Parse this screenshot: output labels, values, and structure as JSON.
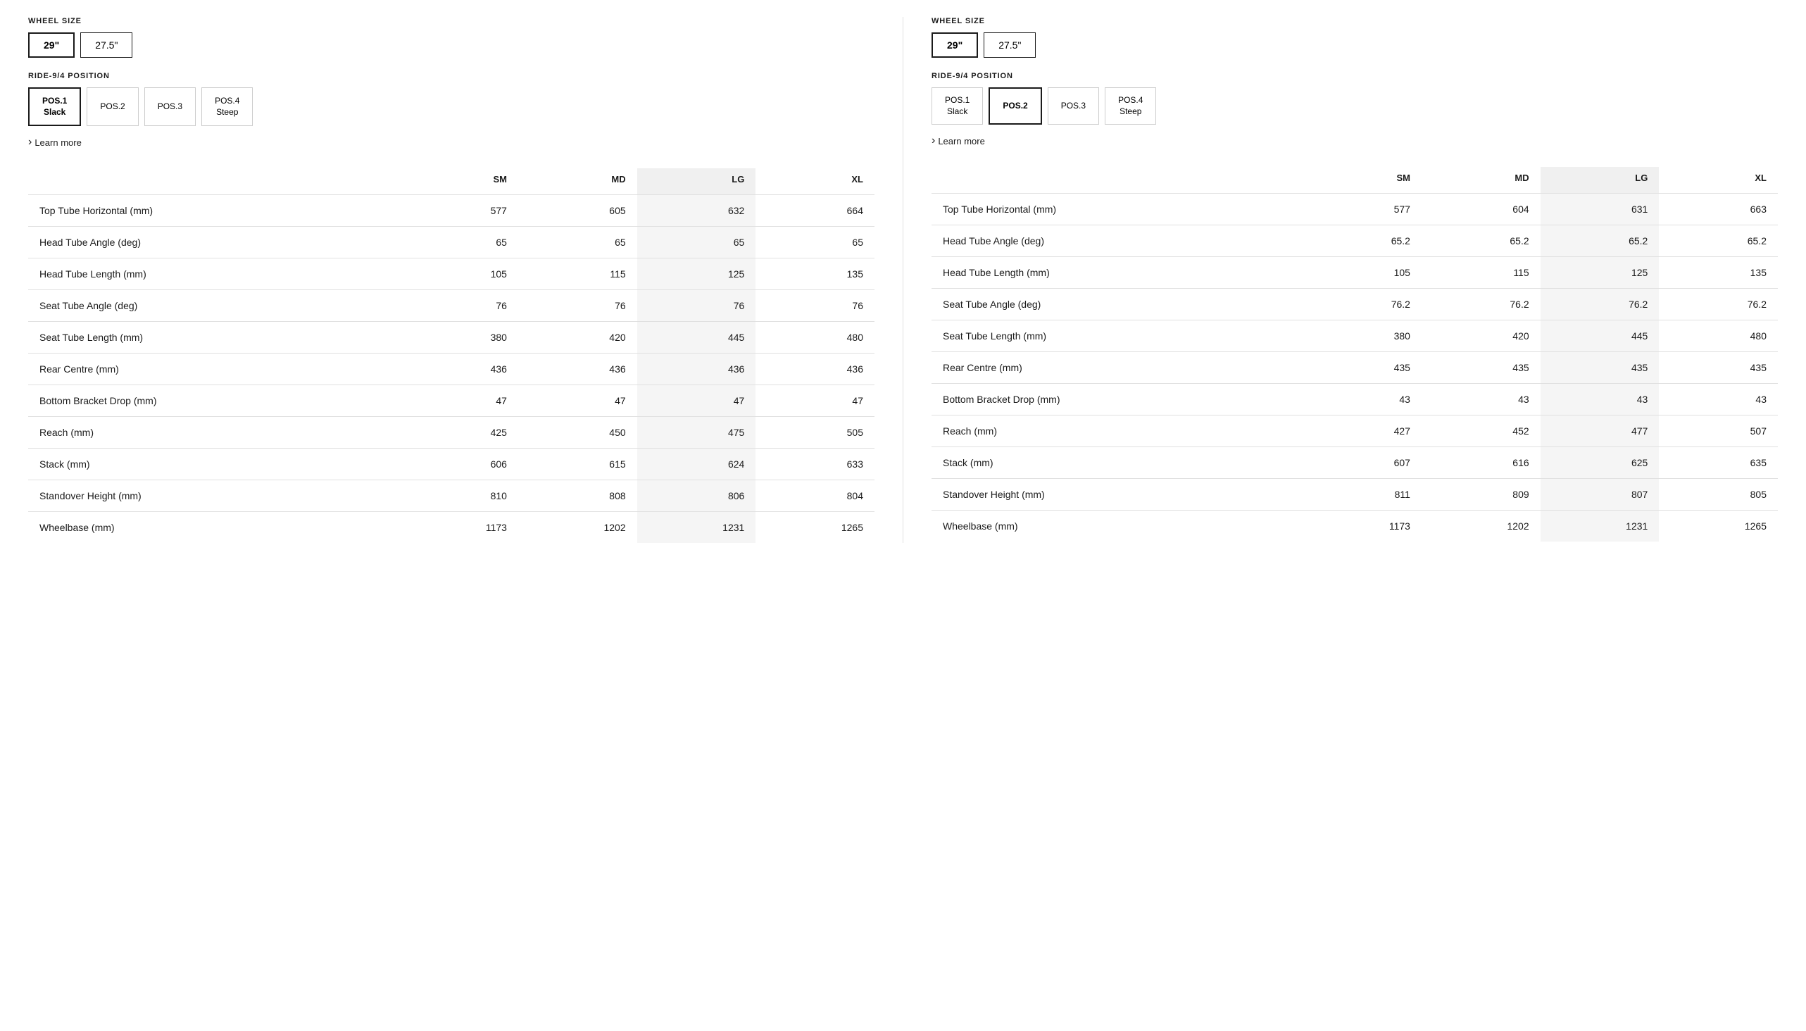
{
  "left": {
    "wheelSize": {
      "label": "WHEEL SIZE",
      "options": [
        "29\"",
        "27.5\""
      ],
      "active": "29\""
    },
    "ridePosition": {
      "label": "RIDE-9/4 POSITION",
      "options": [
        {
          "id": "pos1",
          "label": "POS.1\nSlack"
        },
        {
          "id": "pos2",
          "label": "POS.2"
        },
        {
          "id": "pos3",
          "label": "POS.3"
        },
        {
          "id": "pos4",
          "label": "POS.4\nSteep"
        }
      ],
      "active": "pos1"
    },
    "learnMore": "Learn more",
    "table": {
      "headers": [
        "",
        "SM",
        "MD",
        "LG",
        "XL"
      ],
      "highlightCol": 3,
      "rows": [
        {
          "label": "Top Tube Horizontal (mm)",
          "values": [
            "577",
            "605",
            "632",
            "664"
          ]
        },
        {
          "label": "Head Tube Angle (deg)",
          "values": [
            "65",
            "65",
            "65",
            "65"
          ]
        },
        {
          "label": "Head Tube Length (mm)",
          "values": [
            "105",
            "115",
            "125",
            "135"
          ]
        },
        {
          "label": "Seat Tube Angle (deg)",
          "values": [
            "76",
            "76",
            "76",
            "76"
          ]
        },
        {
          "label": "Seat Tube Length (mm)",
          "values": [
            "380",
            "420",
            "445",
            "480"
          ]
        },
        {
          "label": "Rear Centre (mm)",
          "values": [
            "436",
            "436",
            "436",
            "436"
          ]
        },
        {
          "label": "Bottom Bracket Drop (mm)",
          "values": [
            "47",
            "47",
            "47",
            "47"
          ]
        },
        {
          "label": "Reach (mm)",
          "values": [
            "425",
            "450",
            "475",
            "505"
          ]
        },
        {
          "label": "Stack (mm)",
          "values": [
            "606",
            "615",
            "624",
            "633"
          ]
        },
        {
          "label": "Standover Height (mm)",
          "values": [
            "810",
            "808",
            "806",
            "804"
          ]
        },
        {
          "label": "Wheelbase (mm)",
          "values": [
            "1173",
            "1202",
            "1231",
            "1265"
          ]
        }
      ]
    }
  },
  "right": {
    "wheelSize": {
      "label": "WHEEL SIZE",
      "options": [
        "29\"",
        "27.5\""
      ],
      "active": "29\""
    },
    "ridePosition": {
      "label": "RIDE-9/4 POSITION",
      "options": [
        {
          "id": "pos1",
          "label": "POS.1\nSlack"
        },
        {
          "id": "pos2",
          "label": "POS.2"
        },
        {
          "id": "pos3",
          "label": "POS.3"
        },
        {
          "id": "pos4",
          "label": "POS.4\nSteep"
        }
      ],
      "active": "pos2"
    },
    "learnMore": "Learn more",
    "table": {
      "headers": [
        "",
        "SM",
        "MD",
        "LG",
        "XL"
      ],
      "highlightCol": 3,
      "rows": [
        {
          "label": "Top Tube Horizontal (mm)",
          "values": [
            "577",
            "604",
            "631",
            "663"
          ]
        },
        {
          "label": "Head Tube Angle (deg)",
          "values": [
            "65.2",
            "65.2",
            "65.2",
            "65.2"
          ]
        },
        {
          "label": "Head Tube Length (mm)",
          "values": [
            "105",
            "115",
            "125",
            "135"
          ]
        },
        {
          "label": "Seat Tube Angle (deg)",
          "values": [
            "76.2",
            "76.2",
            "76.2",
            "76.2"
          ]
        },
        {
          "label": "Seat Tube Length (mm)",
          "values": [
            "380",
            "420",
            "445",
            "480"
          ]
        },
        {
          "label": "Rear Centre (mm)",
          "values": [
            "435",
            "435",
            "435",
            "435"
          ]
        },
        {
          "label": "Bottom Bracket Drop (mm)",
          "values": [
            "43",
            "43",
            "43",
            "43"
          ]
        },
        {
          "label": "Reach (mm)",
          "values": [
            "427",
            "452",
            "477",
            "507"
          ]
        },
        {
          "label": "Stack (mm)",
          "values": [
            "607",
            "616",
            "625",
            "635"
          ]
        },
        {
          "label": "Standover Height (mm)",
          "values": [
            "811",
            "809",
            "807",
            "805"
          ]
        },
        {
          "label": "Wheelbase (mm)",
          "values": [
            "1173",
            "1202",
            "1231",
            "1265"
          ]
        }
      ]
    }
  }
}
